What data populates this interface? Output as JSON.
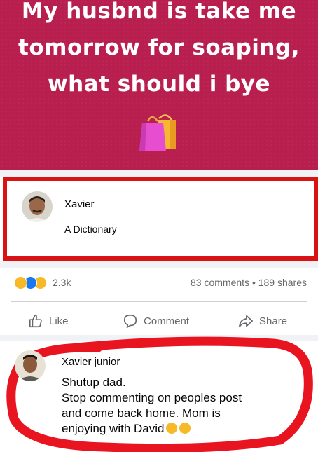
{
  "post": {
    "text_lines": [
      "My husbnd is take me",
      "tomorrow for soaping,",
      "what should i bye"
    ],
    "bag_icon": "shopping-bags-icon",
    "background_color": "#b81f4e"
  },
  "first_comment": {
    "author": "Xavier",
    "text": "A Dictionary",
    "highlight_color": "#d91313"
  },
  "reactions": {
    "icons": [
      "haha-reaction-icon",
      "like-reaction-icon",
      "sad-reaction-icon"
    ],
    "count": "2.3k",
    "stats": "83 comments • 189 shares"
  },
  "actions": {
    "like": "Like",
    "comment": "Comment",
    "share": "Share"
  },
  "second_comment": {
    "author": "Xavier junior",
    "lines": [
      "Shutup dad.",
      "Stop commenting on peoples post",
      "and come back home. Mom is",
      "enjoying with David"
    ],
    "emojis": [
      "grimace-emoji-icon",
      "rolling-eyes-emoji-icon"
    ]
  }
}
